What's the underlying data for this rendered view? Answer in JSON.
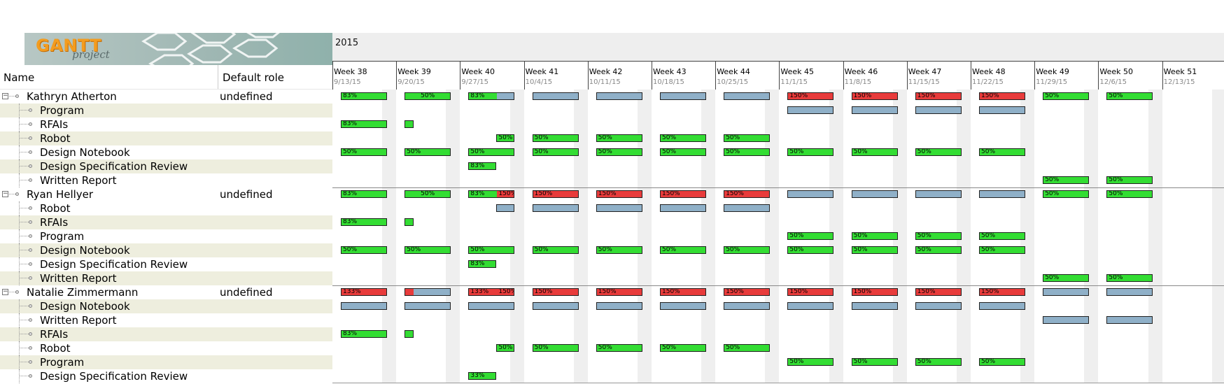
{
  "app": {
    "logo_main": "GANTT",
    "logo_sub": "project"
  },
  "timeline": {
    "year": "2015",
    "weeks": [
      {
        "name": "Week 38",
        "date": "9/13/15"
      },
      {
        "name": "Week 39",
        "date": "9/20/15"
      },
      {
        "name": "Week 40",
        "date": "9/27/15"
      },
      {
        "name": "Week 41",
        "date": "10/4/15"
      },
      {
        "name": "Week 42",
        "date": "10/11/15"
      },
      {
        "name": "Week 43",
        "date": "10/18/15"
      },
      {
        "name": "Week 44",
        "date": "10/25/15"
      },
      {
        "name": "Week 45",
        "date": "11/1/15"
      },
      {
        "name": "Week 46",
        "date": "11/8/15"
      },
      {
        "name": "Week 47",
        "date": "11/15/15"
      },
      {
        "name": "Week 48",
        "date": "11/22/15"
      },
      {
        "name": "Week 49",
        "date": "11/29/15"
      },
      {
        "name": "Week 50",
        "date": "12/6/15"
      },
      {
        "name": "Week 51",
        "date": "12/13/15"
      }
    ]
  },
  "table": {
    "col_name": "Name",
    "col_role": "Default role"
  },
  "rows": [
    {
      "type": "person",
      "name": "Kathryn Atherton",
      "role": "undefined",
      "bars": [
        {
          "w": 0,
          "c": "green",
          "t": "83%"
        },
        {
          "w": 1,
          "c": "green",
          "t": "50%",
          "center": true
        },
        {
          "w": 2,
          "c": "mixed83",
          "t": "83%"
        },
        {
          "w": 3,
          "c": "blue"
        },
        {
          "w": 4,
          "c": "blue"
        },
        {
          "w": 5,
          "c": "blue"
        },
        {
          "w": 6,
          "c": "blue"
        },
        {
          "w": 7,
          "c": "red",
          "t": "150%"
        },
        {
          "w": 8,
          "c": "red",
          "t": "150%"
        },
        {
          "w": 9,
          "c": "red",
          "t": "150%"
        },
        {
          "w": 10,
          "c": "red",
          "t": "150%"
        },
        {
          "w": 11,
          "c": "green",
          "t": "50%"
        },
        {
          "w": 12,
          "c": "green",
          "t": "50%"
        }
      ]
    },
    {
      "type": "task",
      "name": "Program",
      "bars": [
        {
          "w": 7,
          "c": "blue"
        },
        {
          "w": 8,
          "c": "blue"
        },
        {
          "w": 9,
          "c": "blue"
        },
        {
          "w": 10,
          "c": "blue"
        }
      ]
    },
    {
      "type": "task",
      "name": "RFAIs",
      "bars": [
        {
          "w": 0,
          "c": "green",
          "t": "83%"
        },
        {
          "w": 1,
          "c": "green",
          "small": true
        }
      ]
    },
    {
      "type": "task",
      "name": "Robot",
      "bars": [
        {
          "w": 2,
          "c": "green",
          "t": "50%",
          "half": true
        },
        {
          "w": 3,
          "c": "green",
          "t": "50%"
        },
        {
          "w": 4,
          "c": "green",
          "t": "50%"
        },
        {
          "w": 5,
          "c": "green",
          "t": "50%"
        },
        {
          "w": 6,
          "c": "green",
          "t": "50%"
        }
      ]
    },
    {
      "type": "task",
      "name": "Design Notebook",
      "bars": [
        {
          "w": 0,
          "c": "green",
          "t": "50%"
        },
        {
          "w": 1,
          "c": "green",
          "t": "50%"
        },
        {
          "w": 2,
          "c": "green",
          "t": "50%"
        },
        {
          "w": 3,
          "c": "green",
          "t": "50%"
        },
        {
          "w": 4,
          "c": "green",
          "t": "50%"
        },
        {
          "w": 5,
          "c": "green",
          "t": "50%"
        },
        {
          "w": 6,
          "c": "green",
          "t": "50%"
        },
        {
          "w": 7,
          "c": "green",
          "t": "50%"
        },
        {
          "w": 8,
          "c": "green",
          "t": "50%"
        },
        {
          "w": 9,
          "c": "green",
          "t": "50%"
        },
        {
          "w": 10,
          "c": "green",
          "t": "50%"
        }
      ]
    },
    {
      "type": "task",
      "name": "Design Specification Review",
      "bars": [
        {
          "w": 2,
          "c": "green",
          "t": "83%",
          "firsthalf": true
        }
      ]
    },
    {
      "type": "task",
      "name": "Written Report",
      "bars": [
        {
          "w": 11,
          "c": "green",
          "t": "50%"
        },
        {
          "w": 12,
          "c": "green",
          "t": "50%"
        }
      ]
    },
    {
      "type": "person",
      "name": "Ryan Hellyer",
      "role": "undefined",
      "bars": [
        {
          "w": 0,
          "c": "green",
          "t": "83%"
        },
        {
          "w": 1,
          "c": "green",
          "t": "50%",
          "center": true
        },
        {
          "w": 2,
          "c": "split",
          "t": "83%",
          "t2": "150%"
        },
        {
          "w": 3,
          "c": "red",
          "t": "150%"
        },
        {
          "w": 4,
          "c": "red",
          "t": "150%"
        },
        {
          "w": 5,
          "c": "red",
          "t": "150%"
        },
        {
          "w": 6,
          "c": "red",
          "t": "150%"
        },
        {
          "w": 7,
          "c": "blue"
        },
        {
          "w": 8,
          "c": "blue"
        },
        {
          "w": 9,
          "c": "blue"
        },
        {
          "w": 10,
          "c": "blue"
        },
        {
          "w": 11,
          "c": "green",
          "t": "50%"
        },
        {
          "w": 12,
          "c": "green",
          "t": "50%"
        }
      ]
    },
    {
      "type": "task",
      "name": "Robot",
      "bars": [
        {
          "w": 2,
          "c": "blue",
          "half": true
        },
        {
          "w": 3,
          "c": "blue"
        },
        {
          "w": 4,
          "c": "blue"
        },
        {
          "w": 5,
          "c": "blue"
        },
        {
          "w": 6,
          "c": "blue"
        }
      ]
    },
    {
      "type": "task",
      "name": "RFAIs",
      "bars": [
        {
          "w": 0,
          "c": "green",
          "t": "83%"
        },
        {
          "w": 1,
          "c": "green",
          "small": true
        }
      ]
    },
    {
      "type": "task",
      "name": "Program",
      "bars": [
        {
          "w": 7,
          "c": "green",
          "t": "50%"
        },
        {
          "w": 8,
          "c": "green",
          "t": "50%"
        },
        {
          "w": 9,
          "c": "green",
          "t": "50%"
        },
        {
          "w": 10,
          "c": "green",
          "t": "50%"
        }
      ]
    },
    {
      "type": "task",
      "name": "Design Notebook",
      "bars": [
        {
          "w": 0,
          "c": "green",
          "t": "50%"
        },
        {
          "w": 1,
          "c": "green",
          "t": "50%"
        },
        {
          "w": 2,
          "c": "green",
          "t": "50%"
        },
        {
          "w": 3,
          "c": "green",
          "t": "50%"
        },
        {
          "w": 4,
          "c": "green",
          "t": "50%"
        },
        {
          "w": 5,
          "c": "green",
          "t": "50%"
        },
        {
          "w": 6,
          "c": "green",
          "t": "50%"
        },
        {
          "w": 7,
          "c": "green",
          "t": "50%"
        },
        {
          "w": 8,
          "c": "green",
          "t": "50%"
        },
        {
          "w": 9,
          "c": "green",
          "t": "50%"
        },
        {
          "w": 10,
          "c": "green",
          "t": "50%"
        }
      ]
    },
    {
      "type": "task",
      "name": "Design Specification Review",
      "bars": [
        {
          "w": 2,
          "c": "green",
          "t": "83%",
          "firsthalf": true
        }
      ]
    },
    {
      "type": "task",
      "name": "Written Report",
      "bars": [
        {
          "w": 11,
          "c": "green",
          "t": "50%"
        },
        {
          "w": 12,
          "c": "green",
          "t": "50%"
        }
      ]
    },
    {
      "type": "person",
      "name": "Natalie Zimmermann",
      "role": "undefined",
      "bars": [
        {
          "w": 0,
          "c": "red",
          "t": "133%"
        },
        {
          "w": 1,
          "c": "redblue"
        },
        {
          "w": 2,
          "c": "red",
          "t": "133%",
          "t2": "150%"
        },
        {
          "w": 3,
          "c": "red",
          "t": "150%"
        },
        {
          "w": 4,
          "c": "red",
          "t": "150%"
        },
        {
          "w": 5,
          "c": "red",
          "t": "150%"
        },
        {
          "w": 6,
          "c": "red",
          "t": "150%"
        },
        {
          "w": 7,
          "c": "red",
          "t": "150%"
        },
        {
          "w": 8,
          "c": "red",
          "t": "150%"
        },
        {
          "w": 9,
          "c": "red",
          "t": "150%"
        },
        {
          "w": 10,
          "c": "red",
          "t": "150%"
        },
        {
          "w": 11,
          "c": "blue"
        },
        {
          "w": 12,
          "c": "blue"
        }
      ]
    },
    {
      "type": "task",
      "name": "Design Notebook",
      "bars": [
        {
          "w": 0,
          "c": "blue"
        },
        {
          "w": 1,
          "c": "blue"
        },
        {
          "w": 2,
          "c": "blue"
        },
        {
          "w": 3,
          "c": "blue"
        },
        {
          "w": 4,
          "c": "blue"
        },
        {
          "w": 5,
          "c": "blue"
        },
        {
          "w": 6,
          "c": "blue"
        },
        {
          "w": 7,
          "c": "blue"
        },
        {
          "w": 8,
          "c": "blue"
        },
        {
          "w": 9,
          "c": "blue"
        },
        {
          "w": 10,
          "c": "blue"
        }
      ]
    },
    {
      "type": "task",
      "name": "Written Report",
      "bars": [
        {
          "w": 11,
          "c": "blue"
        },
        {
          "w": 12,
          "c": "blue"
        }
      ]
    },
    {
      "type": "task",
      "name": "RFAIs",
      "bars": [
        {
          "w": 0,
          "c": "green",
          "t": "83%"
        },
        {
          "w": 1,
          "c": "green",
          "small": true
        }
      ]
    },
    {
      "type": "task",
      "name": "Robot",
      "bars": [
        {
          "w": 2,
          "c": "green",
          "t": "50%",
          "half": true
        },
        {
          "w": 3,
          "c": "green",
          "t": "50%"
        },
        {
          "w": 4,
          "c": "green",
          "t": "50%"
        },
        {
          "w": 5,
          "c": "green",
          "t": "50%"
        },
        {
          "w": 6,
          "c": "green",
          "t": "50%"
        }
      ]
    },
    {
      "type": "task",
      "name": "Program",
      "bars": [
        {
          "w": 7,
          "c": "green",
          "t": "50%"
        },
        {
          "w": 8,
          "c": "green",
          "t": "50%"
        },
        {
          "w": 9,
          "c": "green",
          "t": "50%"
        },
        {
          "w": 10,
          "c": "green",
          "t": "50%"
        }
      ]
    },
    {
      "type": "task",
      "name": "Design Specification Review",
      "bars": [
        {
          "w": 2,
          "c": "green",
          "t": "33%",
          "firsthalf": true
        }
      ]
    }
  ],
  "colors": {
    "green": "#33dd33",
    "blue": "#8fb0c8",
    "red": "#e83b3b",
    "stripe": "#eeeede"
  }
}
